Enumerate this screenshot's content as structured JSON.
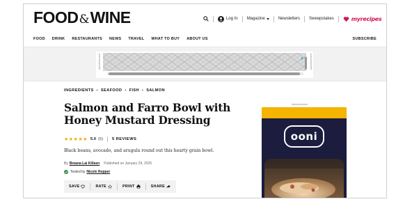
{
  "header": {
    "logo": {
      "word1": "FOOD",
      "amp": "&",
      "word2": "WINE"
    },
    "utility": {
      "login_label": "Log In",
      "magazine_label": "Magazine",
      "newsletters_label": "Newsletters",
      "sweepstakes_label": "Sweepstakes",
      "myrecipes_label": "myrecipes"
    },
    "nav": {
      "items": [
        "FOOD",
        "DRINK",
        "RESTAURANTS",
        "NEWS",
        "TRAVEL",
        "WHAT TO BUY",
        "ABOUT US"
      ],
      "subscribe_label": "SUBSCRIBE"
    }
  },
  "ad_banner": {
    "label": "Advertisement"
  },
  "breadcrumb": [
    "INGREDIENTS",
    "SEAFOOD",
    "FISH",
    "SALMON"
  ],
  "article": {
    "title": "Salmon and Farro Bowl with Honey Mustard Dressing",
    "rating": {
      "stars": "★★★★★",
      "value": "5.0",
      "count": "(5)",
      "reviews_label": "5 REVIEWS"
    },
    "dek": "Black beans, avocado, and arugula round out this hearty grain bowl.",
    "byline": {
      "by": "By",
      "author": "Breana Lai Killeen",
      "published": "Published on January 29, 2025"
    },
    "tested": {
      "label": "Tested by",
      "tester": "Nicole Hopper"
    },
    "actions": {
      "save": "SAVE",
      "rate": "RATE",
      "print": "PRINT",
      "share": "SHARE"
    }
  },
  "side_ad": {
    "label": "Advertisement",
    "brand": "ooni"
  },
  "colors": {
    "star": "#f2a900",
    "myrecipes": "#d2145a",
    "ad_navy": "#1b1c3e",
    "ad_yellow": "#f4b400",
    "tested_check": "#2e8b3a"
  }
}
